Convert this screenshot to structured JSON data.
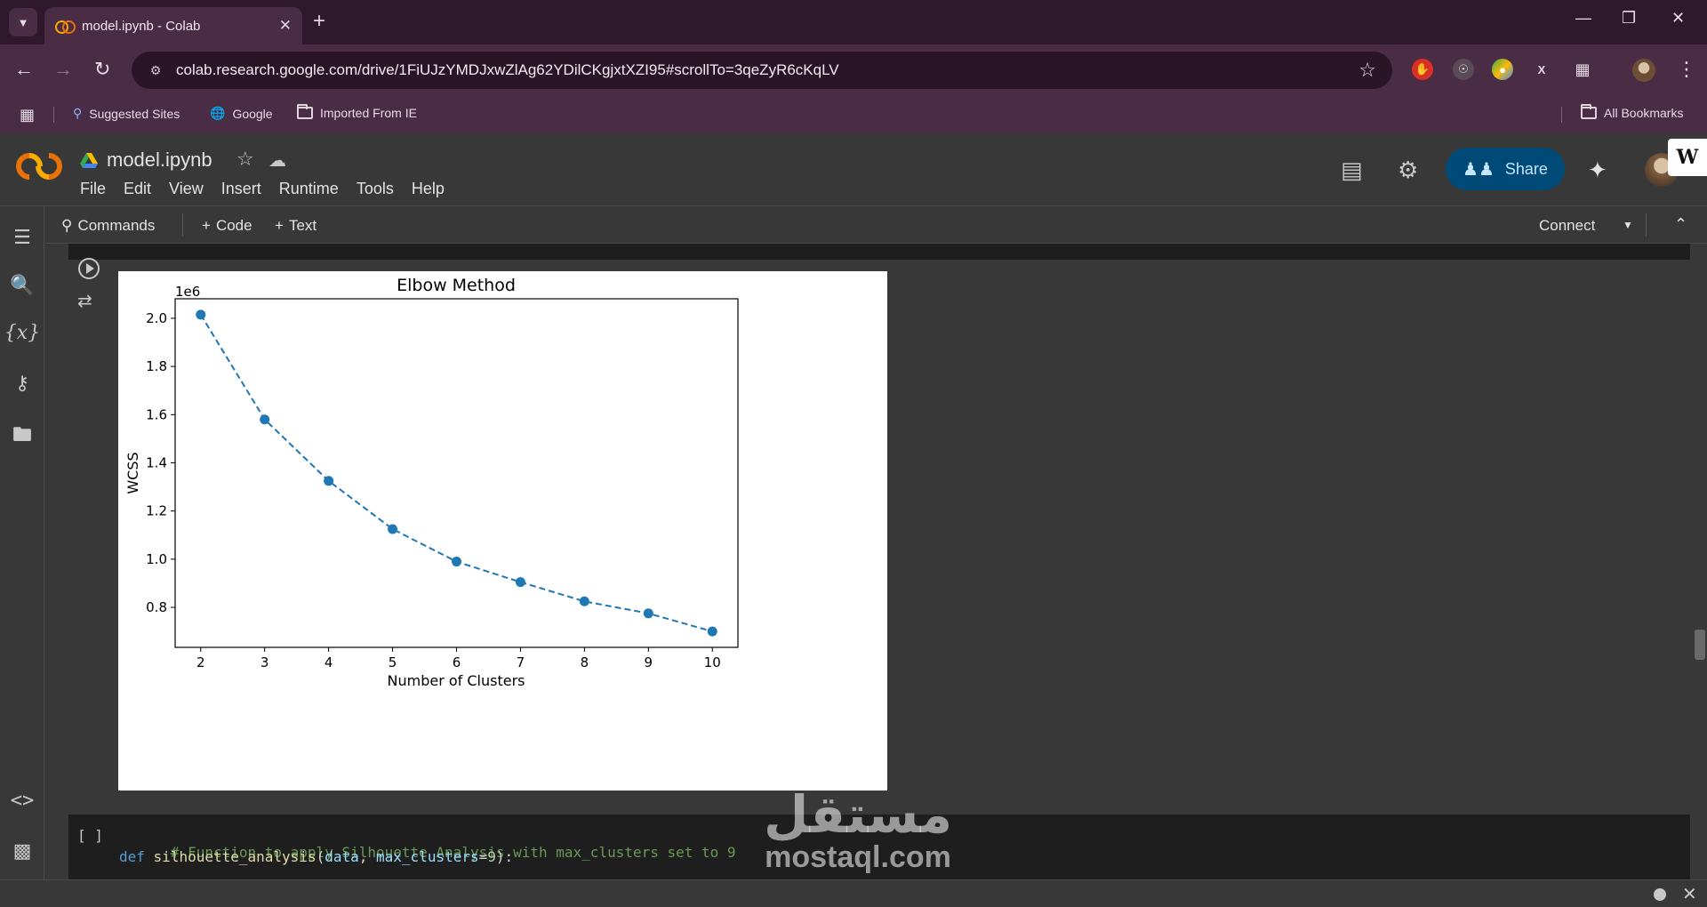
{
  "browser": {
    "tab_title": "model.ipynb - Colab",
    "url": "colab.research.google.com/drive/1FiUJzYMDJxwZlAg62YDilCKgjxtXZI95#scrollTo=3qeZyR6cKqLV",
    "bookmarks": [
      "Suggested Sites",
      "Google",
      "Imported From IE"
    ],
    "all_bookmarks": "All Bookmarks"
  },
  "colab": {
    "notebook_title": "model.ipynb",
    "menu": [
      "File",
      "Edit",
      "View",
      "Insert",
      "Runtime",
      "Tools",
      "Help"
    ],
    "share_label": "Share",
    "toolbar": {
      "commands": "Commands",
      "code": "Code",
      "text": "Text",
      "connect": "Connect"
    }
  },
  "code_cell": {
    "bracket": "[ ]",
    "comment": "# Function to apply Silhouette Analysis with max_clusters set to 9",
    "def_kw": "def",
    "fn_name": "silhouette_analysis",
    "param1": "data",
    "param2": "max_clusters",
    "default_val": "9"
  },
  "watermark": {
    "arabic": "مستقل",
    "latin": "mostaql.com"
  },
  "colors": {
    "series": "#1f77b4",
    "share_bg": "#004a77",
    "chrome_bg": "#4a2c44"
  },
  "chart_data": {
    "type": "line",
    "title": "Elbow Method",
    "xlabel": "Number of Clusters",
    "ylabel": "WCSS",
    "offset_label": "1e6",
    "x": [
      2,
      3,
      4,
      5,
      6,
      7,
      8,
      9,
      10
    ],
    "y": [
      2.015,
      1.58,
      1.325,
      1.125,
      0.99,
      0.905,
      0.825,
      0.775,
      0.7
    ],
    "xticks": [
      "2",
      "3",
      "4",
      "5",
      "6",
      "7",
      "8",
      "9",
      "10"
    ],
    "yticks": [
      "0.8",
      "1.0",
      "1.2",
      "1.4",
      "1.6",
      "1.8",
      "2.0"
    ],
    "xlim": [
      1.6,
      10.4
    ],
    "ylim": [
      0.634,
      2.081
    ],
    "line_style": "dashed",
    "marker": "circle",
    "grid": false
  }
}
